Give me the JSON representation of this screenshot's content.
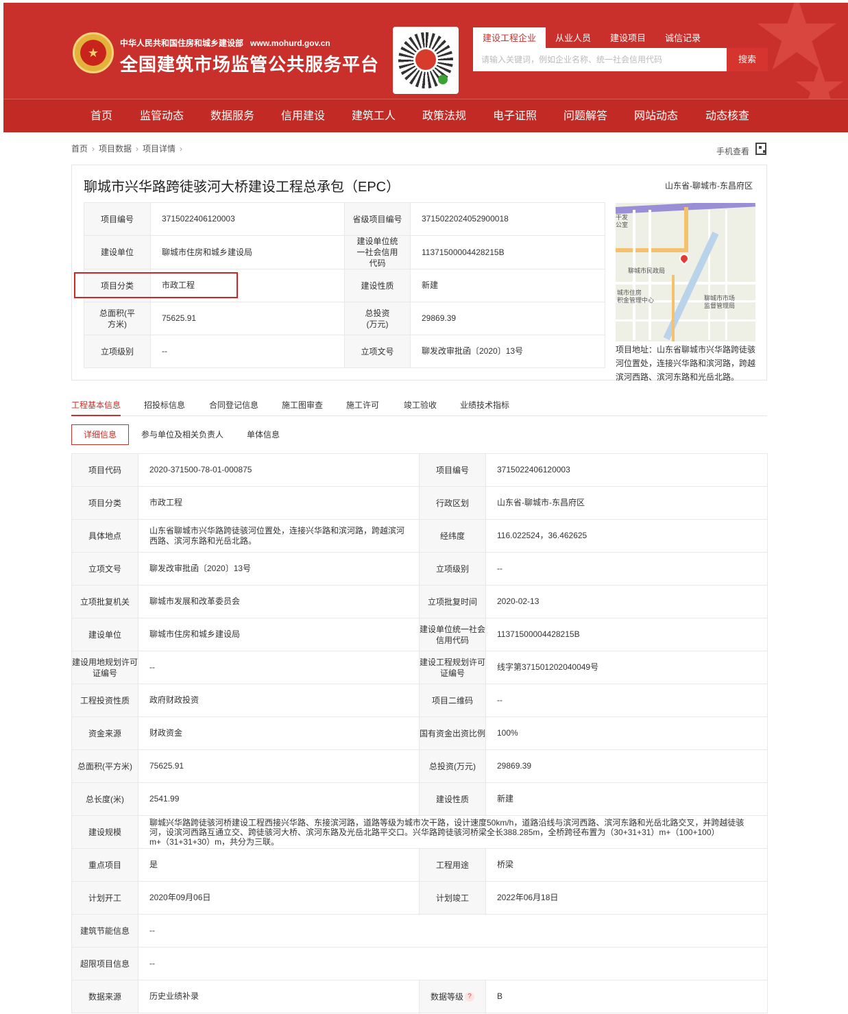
{
  "header": {
    "ministry": "中华人民共和国住房和城乡建设部",
    "url": "www.mohurd.gov.cn",
    "title": "全国建筑市场监管公共服务平台",
    "search_tabs": [
      "建设工程企业",
      "从业人员",
      "建设项目",
      "诚信记录"
    ],
    "search_placeholder": "请输入关键词，例如企业名称、统一社会信用代码",
    "search_button": "搜索",
    "nav": [
      "首页",
      "监管动态",
      "数据服务",
      "信用建设",
      "建筑工人",
      "政策法规",
      "电子证照",
      "问题解答",
      "网站动态",
      "动态核查"
    ]
  },
  "breadcrumb": [
    "首页",
    "项目数据",
    "项目详情"
  ],
  "mobile_view": "手机查看",
  "project": {
    "title": "聊城市兴华路跨徒骇河大桥建设工程总承包（EPC）",
    "region": "山东省-聊城市-东昌府区",
    "summary": [
      {
        "k1": "项目编号",
        "v1": "3715022406120003",
        "k2": "省级项目编号",
        "v2": "3715022024052900018"
      },
      {
        "k1": "建设单位",
        "v1": "聊城市住房和城乡建设局",
        "k2": "建设单位统一社会信用代码",
        "v2": "11371500004428215B"
      },
      {
        "k1": "项目分类",
        "v1": "市政工程",
        "k2": "建设性质",
        "v2": "新建"
      },
      {
        "k1": "总面积(平方米)",
        "v1": "75625.91",
        "k2": "总投资(万元)",
        "v2": "29869.39"
      },
      {
        "k1": "立项级别",
        "v1": "--",
        "k2": "立项文号",
        "v2": "聊发改审批函〔2020〕13号"
      }
    ],
    "address": "项目地址：山东省聊城市兴华路跨徒骇河位置处，连接兴华路和滨河路，跨越滨河西路、滨河东路和光岳北路。"
  },
  "map_labels": {
    "top_left": "干发\n公室",
    "gov": "聊城市民政局",
    "fund": "城市住房\n积金管理中心",
    "market": "聊城市市场\n监督管理局"
  },
  "tabs_main": [
    "工程基本信息",
    "招投标信息",
    "合同登记信息",
    "施工图审查",
    "施工许可",
    "竣工验收",
    "业绩技术指标"
  ],
  "tabs_sub": [
    "详细信息",
    "参与单位及相关负责人",
    "单体信息"
  ],
  "details": {
    "rows": [
      {
        "k1": "项目代码",
        "v1": "2020-371500-78-01-000875",
        "k2": "项目编号",
        "v2": "3715022406120003"
      },
      {
        "k1": "项目分类",
        "v1": "市政工程",
        "k2": "行政区划",
        "v2": "山东省-聊城市-东昌府区"
      },
      {
        "k1": "具体地点",
        "v1": "山东省聊城市兴华路跨徒骇河位置处，连接兴华路和滨河路，跨越滨河西路、滨河东路和光岳北路。",
        "k2": "经纬度",
        "v2": "116.022524，36.462625"
      },
      {
        "k1": "立项文号",
        "v1": "聊发改审批函〔2020〕13号",
        "k2": "立项级别",
        "v2": "--"
      },
      {
        "k1": "立项批复机关",
        "v1": "聊城市发展和改革委员会",
        "k2": "立项批复时间",
        "v2": "2020-02-13"
      },
      {
        "k1": "建设单位",
        "v1": "聊城市住房和城乡建设局",
        "k2": "建设单位统一社会信用代码",
        "v2": "11371500004428215B"
      },
      {
        "k1": "建设用地规划许可证编号",
        "v1": "--",
        "k2": "建设工程规划许可证编号",
        "v2": "线字第371501202040049号"
      },
      {
        "k1": "工程投资性质",
        "v1": "政府财政投资",
        "k2": "项目二维码",
        "v2": "--"
      },
      {
        "k1": "资金来源",
        "v1": "财政资金",
        "k2": "国有资金出资比例",
        "v2": "100%"
      },
      {
        "k1": "总面积(平方米)",
        "v1": "75625.91",
        "k2": "总投资(万元)",
        "v2": "29869.39"
      },
      {
        "k1": "总长度(米)",
        "v1": "2541.99",
        "k2": "建设性质",
        "v2": "新建"
      }
    ],
    "scale_label": "建设规模",
    "scale_value": "聊城兴华路跨徒骇河桥建设工程西接兴华路、东接滨河路，道路等级为城市次干路，设计速度50km/h，道路沿线与滨河西路、滨河东路和光岳北路交叉，并跨越徒骇河，设滨河西路互通立交、跨徒骇河大桥、滨河东路及光岳北路平交口。兴华路跨徒骇河桥梁全长388.285m，全桥跨径布置为（30+31+31）m+（100+100）m+（31+31+30）m，共分为三联。",
    "rows2": [
      {
        "k1": "重点项目",
        "v1": "是",
        "k2": "工程用途",
        "v2": "桥梁"
      },
      {
        "k1": "计划开工",
        "v1": "2020年09月06日",
        "k2": "计划竣工",
        "v2": "2022年06月18日"
      }
    ],
    "energy_label": "建筑节能信息",
    "energy_value": "--",
    "overlimit_label": "超限项目信息",
    "overlimit_value": "--",
    "source_label": "数据来源",
    "source_value": "历史业绩补录",
    "grade_label": "数据等级",
    "grade_help": "?",
    "grade_value": "B"
  },
  "colors": {
    "brand_red": "#c9302b",
    "highlight": "#d32424"
  }
}
